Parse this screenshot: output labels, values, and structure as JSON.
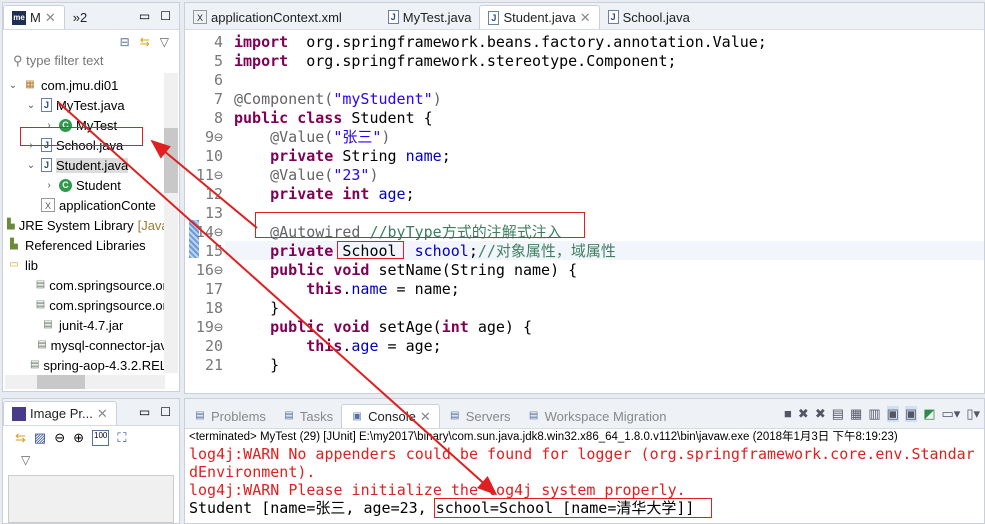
{
  "explorer": {
    "tab_label": "M",
    "overflow_label": "»2",
    "filter_placeholder": "type filter text",
    "items": [
      {
        "label": "com.jmu.di01",
        "twisty": "v",
        "icon": "package-icon"
      },
      {
        "label": "MyTest.java",
        "twisty": "v",
        "icon": "java-file-icon"
      },
      {
        "label": "MyTest",
        "twisty": ">",
        "icon": "class-icon"
      },
      {
        "label": "School.java",
        "twisty": ">",
        "icon": "java-file-icon"
      },
      {
        "label": "Student.java",
        "twisty": "v",
        "icon": "java-file-icon"
      },
      {
        "label": "Student",
        "twisty": ">",
        "icon": "class-icon"
      },
      {
        "label": "applicationConte",
        "twisty": "",
        "icon": "xml-file-icon"
      },
      {
        "label": "JRE System Library",
        "suffix": "[Java",
        "twisty": "",
        "icon": "library-icon"
      },
      {
        "label": "Referenced Libraries",
        "twisty": "",
        "icon": "library-icon"
      },
      {
        "label": "lib",
        "twisty": "",
        "icon": "folder-icon"
      },
      {
        "label": "com.springsource.or",
        "icon": "jar-icon"
      },
      {
        "label": "com.springsource.or",
        "icon": "jar-icon"
      },
      {
        "label": "junit-4.7.jar",
        "icon": "jar-icon"
      },
      {
        "label": "mysql-connector-jav",
        "icon": "jar-icon"
      },
      {
        "label": "spring-aop-4.3.2.REL",
        "icon": "jar-icon"
      }
    ]
  },
  "image_preview": {
    "title": "Image Pr..."
  },
  "editor": {
    "tabs": [
      "applicationContext.xml",
      "MyTest.java",
      "Student.java",
      "School.java"
    ],
    "active_tab": "Student.java",
    "lines": [
      {
        "n": "4",
        "t": [
          [
            "kw",
            "import"
          ],
          [
            "",
            "  org.springframework.beans.factory.annotation.Value;"
          ]
        ]
      },
      {
        "n": "5",
        "t": [
          [
            "kw",
            "import"
          ],
          [
            "",
            "  org.springframework.stereotype.Component;"
          ]
        ]
      },
      {
        "n": "6",
        "t": []
      },
      {
        "n": "7",
        "t": [
          [
            "ann",
            "@Component("
          ],
          [
            "str",
            "\"myStudent\""
          ],
          [
            "ann",
            ")"
          ]
        ]
      },
      {
        "n": "8",
        "t": [
          [
            "kw",
            "public class"
          ],
          [
            "",
            " Student {"
          ]
        ]
      },
      {
        "n": "9⊖",
        "t": [
          [
            "",
            "    "
          ],
          [
            "ann",
            "@Value("
          ],
          [
            "str",
            "\"张三\""
          ],
          [
            "ann",
            ")"
          ]
        ]
      },
      {
        "n": "10",
        "t": [
          [
            "",
            "    "
          ],
          [
            "kw",
            "private"
          ],
          [
            "",
            " String "
          ],
          [
            "fld",
            "name"
          ],
          [
            "",
            ";"
          ]
        ]
      },
      {
        "n": "11⊖",
        "t": [
          [
            "",
            "    "
          ],
          [
            "ann",
            "@Value("
          ],
          [
            "str",
            "\"23\""
          ],
          [
            "ann",
            ")"
          ]
        ]
      },
      {
        "n": "12",
        "t": [
          [
            "",
            "    "
          ],
          [
            "kw",
            "private int"
          ],
          [
            "",
            " "
          ],
          [
            "fld",
            "age"
          ],
          [
            "",
            ";"
          ]
        ]
      },
      {
        "n": "13",
        "t": []
      },
      {
        "n": "14⊖",
        "t": [
          [
            "",
            "    "
          ],
          [
            "ann",
            "@Autowired "
          ],
          [
            "cm",
            "//byType方式的注解式注入"
          ]
        ]
      },
      {
        "n": "15",
        "t": [
          [
            "",
            "    "
          ],
          [
            "kw",
            "private"
          ],
          [
            "",
            " School  "
          ],
          [
            "fld",
            "school"
          ],
          [
            "",
            ";"
          ],
          [
            "cm",
            "//对象属性，域属性"
          ]
        ]
      },
      {
        "n": "16⊖",
        "t": [
          [
            "",
            "    "
          ],
          [
            "kw",
            "public void"
          ],
          [
            "",
            " setName(String name) {"
          ]
        ]
      },
      {
        "n": "17",
        "t": [
          [
            "",
            "        "
          ],
          [
            "kw",
            "this"
          ],
          [
            "",
            "."
          ],
          [
            "fld",
            "name"
          ],
          [
            "",
            " = name;"
          ]
        ]
      },
      {
        "n": "18",
        "t": [
          [
            "",
            "    }"
          ]
        ]
      },
      {
        "n": "19⊖",
        "t": [
          [
            "",
            "    "
          ],
          [
            "kw",
            "public void"
          ],
          [
            "",
            " setAge("
          ],
          [
            "kw",
            "int"
          ],
          [
            "",
            " age) {"
          ]
        ]
      },
      {
        "n": "20",
        "t": [
          [
            "",
            "        "
          ],
          [
            "kw",
            "this"
          ],
          [
            "",
            "."
          ],
          [
            "fld",
            "age"
          ],
          [
            "",
            " = age;"
          ]
        ]
      },
      {
        "n": "21",
        "t": [
          [
            "",
            "    }"
          ]
        ]
      }
    ]
  },
  "console": {
    "tabs": [
      "Problems",
      "Tasks",
      "Console",
      "Servers",
      "Workspace Migration"
    ],
    "active_tab": "Console",
    "status": "<terminated> MyTest (29) [JUnit] E:\\my2017\\binary\\com.sun.java.jdk8.win32.x86_64_1.8.0.v112\\bin\\javaw.exe (2018年1月3日 下午8:19:23)",
    "lines": [
      {
        "text": "log4j:WARN No appenders could be found for logger (org.springframework.core.env.StandardEnvironment).",
        "color": "#e02020"
      },
      {
        "text": "log4j:WARN Please initialize the log4j system properly.",
        "color": "#e02020"
      },
      {
        "text": "Student [name=张三, age=23, school=School [name=清华大学]]",
        "color": "#000000"
      }
    ]
  },
  "colors": {
    "annotation_red": "#e02020",
    "keyword": "#7f0055",
    "string": "#2a00ff"
  }
}
